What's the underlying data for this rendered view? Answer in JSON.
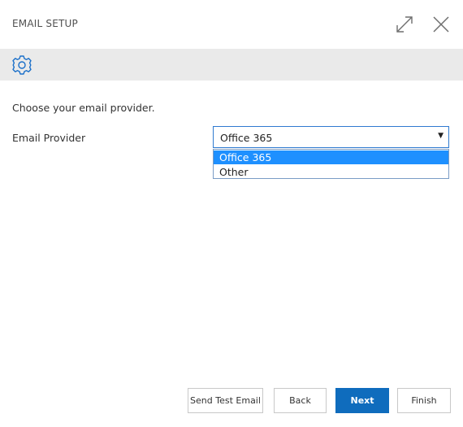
{
  "dialog": {
    "title": "EMAIL SETUP",
    "expand_icon": "expand-icon",
    "close_icon": "close-icon"
  },
  "toolbar": {
    "settings_icon": "gear-icon"
  },
  "content": {
    "instruction": "Choose your email provider.",
    "provider_label": "Email Provider",
    "provider_selected": "Office 365",
    "provider_options": [
      "Office 365",
      "Other"
    ]
  },
  "buttons": {
    "send_test": "Send Test Email",
    "back": "Back",
    "next": "Next",
    "finish": "Finish"
  },
  "colors": {
    "accent": "#0f6cbd",
    "highlight": "#1e90ff",
    "toolbar_bg": "#eaeaea"
  }
}
